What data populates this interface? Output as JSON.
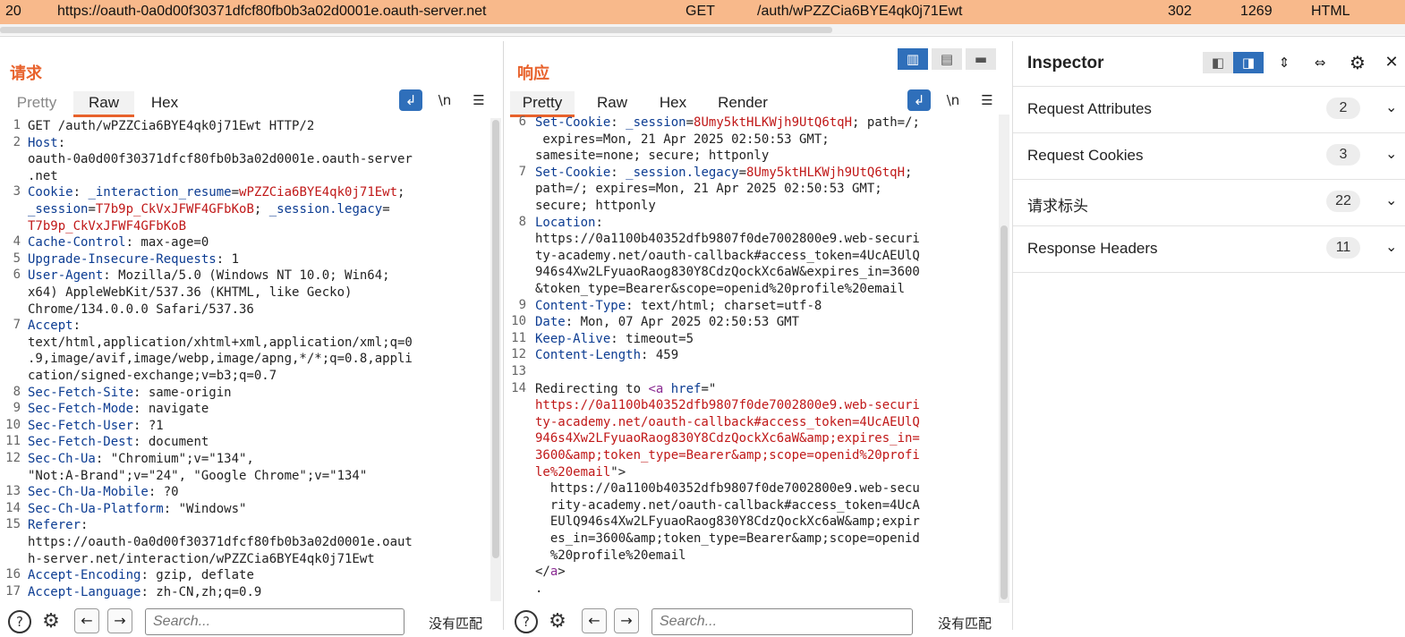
{
  "history_row": {
    "index": "20",
    "host": "https://oauth-0a0d00f30371dfcf80fb0b3a02d0001e.oauth-server.net",
    "method": "GET",
    "url": "/auth/wPZZCia6BYE4qk0j71Ewt",
    "status": "302",
    "length": "1269",
    "mime": "HTML"
  },
  "request": {
    "title": "请求",
    "tabs": [
      "Pretty",
      "Raw",
      "Hex"
    ],
    "active_tab": "Raw",
    "lines": [
      {
        "n": "1",
        "parts": [
          [
            "t",
            "GET /auth/wPZZCia6BYE4qk0j71Ewt HTTP/2"
          ]
        ]
      },
      {
        "n": "2",
        "parts": [
          [
            "h",
            "Host"
          ],
          [
            "t",
            ":"
          ]
        ]
      },
      {
        "n": "",
        "parts": [
          [
            "t",
            "oauth-0a0d00f30371dfcf80fb0b3a02d0001e.oauth-server"
          ]
        ]
      },
      {
        "n": "",
        "parts": [
          [
            "t",
            ".net"
          ]
        ]
      },
      {
        "n": "3",
        "parts": [
          [
            "h",
            "Cookie"
          ],
          [
            "t",
            ": "
          ],
          [
            "h",
            "_interaction_resume"
          ],
          [
            "t",
            "="
          ],
          [
            "c",
            "wPZZCia6BYE4qk0j71Ewt"
          ],
          [
            "t",
            ";"
          ]
        ]
      },
      {
        "n": "",
        "parts": [
          [
            "h",
            "_session"
          ],
          [
            "t",
            "="
          ],
          [
            "c",
            "T7b9p_CkVxJFWF4GFbKoB"
          ],
          [
            "t",
            "; "
          ],
          [
            "h",
            "_session.legacy"
          ],
          [
            "t",
            "="
          ]
        ]
      },
      {
        "n": "",
        "parts": [
          [
            "c",
            "T7b9p_CkVxJFWF4GFbKoB"
          ]
        ]
      },
      {
        "n": "4",
        "parts": [
          [
            "h",
            "Cache-Control"
          ],
          [
            "t",
            ": max-age=0"
          ]
        ]
      },
      {
        "n": "5",
        "parts": [
          [
            "h",
            "Upgrade-Insecure-Requests"
          ],
          [
            "t",
            ": 1"
          ]
        ]
      },
      {
        "n": "6",
        "parts": [
          [
            "h",
            "User-Agent"
          ],
          [
            "t",
            ": Mozilla/5.0 (Windows NT 10.0; Win64;"
          ]
        ]
      },
      {
        "n": "",
        "parts": [
          [
            "t",
            "x64) AppleWebKit/537.36 (KHTML, like Gecko)"
          ]
        ]
      },
      {
        "n": "",
        "parts": [
          [
            "t",
            "Chrome/134.0.0.0 Safari/537.36"
          ]
        ]
      },
      {
        "n": "7",
        "parts": [
          [
            "h",
            "Accept"
          ],
          [
            "t",
            ":"
          ]
        ]
      },
      {
        "n": "",
        "parts": [
          [
            "t",
            "text/html,application/xhtml+xml,application/xml;q=0"
          ]
        ]
      },
      {
        "n": "",
        "parts": [
          [
            "t",
            ".9,image/avif,image/webp,image/apng,*/*;q=0.8,appli"
          ]
        ]
      },
      {
        "n": "",
        "parts": [
          [
            "t",
            "cation/signed-exchange;v=b3;q=0.7"
          ]
        ]
      },
      {
        "n": "8",
        "parts": [
          [
            "h",
            "Sec-Fetch-Site"
          ],
          [
            "t",
            ": same-origin"
          ]
        ]
      },
      {
        "n": "9",
        "parts": [
          [
            "h",
            "Sec-Fetch-Mode"
          ],
          [
            "t",
            ": navigate"
          ]
        ]
      },
      {
        "n": "10",
        "parts": [
          [
            "h",
            "Sec-Fetch-User"
          ],
          [
            "t",
            ": ?1"
          ]
        ]
      },
      {
        "n": "11",
        "parts": [
          [
            "h",
            "Sec-Fetch-Dest"
          ],
          [
            "t",
            ": document"
          ]
        ]
      },
      {
        "n": "12",
        "parts": [
          [
            "h",
            "Sec-Ch-Ua"
          ],
          [
            "t",
            ": \"Chromium\";v=\"134\","
          ]
        ]
      },
      {
        "n": "",
        "parts": [
          [
            "t",
            "\"Not:A-Brand\";v=\"24\", \"Google Chrome\";v=\"134\""
          ]
        ]
      },
      {
        "n": "13",
        "parts": [
          [
            "h",
            "Sec-Ch-Ua-Mobile"
          ],
          [
            "t",
            ": ?0"
          ]
        ]
      },
      {
        "n": "14",
        "parts": [
          [
            "h",
            "Sec-Ch-Ua-Platform"
          ],
          [
            "t",
            ": \"Windows\""
          ]
        ]
      },
      {
        "n": "15",
        "parts": [
          [
            "h",
            "Referer"
          ],
          [
            "t",
            ":"
          ]
        ]
      },
      {
        "n": "",
        "parts": [
          [
            "t",
            "https://oauth-0a0d00f30371dfcf80fb0b3a02d0001e.oaut"
          ]
        ]
      },
      {
        "n": "",
        "parts": [
          [
            "t",
            "h-server.net/interaction/wPZZCia6BYE4qk0j71Ewt"
          ]
        ]
      },
      {
        "n": "16",
        "parts": [
          [
            "h",
            "Accept-Encoding"
          ],
          [
            "t",
            ": gzip, deflate"
          ]
        ]
      },
      {
        "n": "17",
        "parts": [
          [
            "h",
            "Accept-Language"
          ],
          [
            "t",
            ": zh-CN,zh;q=0.9"
          ]
        ]
      }
    ],
    "search_placeholder": "Search...",
    "no_match": "没有匹配"
  },
  "response": {
    "title": "响应",
    "tabs": [
      "Pretty",
      "Raw",
      "Hex",
      "Render"
    ],
    "active_tab": "Pretty",
    "lines": [
      {
        "n": "6",
        "parts": [
          [
            "h",
            "Set-Cookie"
          ],
          [
            "t",
            ": "
          ],
          [
            "h",
            "_session"
          ],
          [
            "t",
            "="
          ],
          [
            "c",
            "8Umy5ktHLKWjh9UtQ6tqH"
          ],
          [
            "t",
            "; path=/;"
          ]
        ]
      },
      {
        "n": "",
        "parts": [
          [
            "t",
            " expires=Mon, 21 Apr 2025 02:50:53 GMT;"
          ]
        ]
      },
      {
        "n": "",
        "parts": [
          [
            "t",
            "samesite=none; secure; httponly"
          ]
        ]
      },
      {
        "n": "7",
        "parts": [
          [
            "h",
            "Set-Cookie"
          ],
          [
            "t",
            ": "
          ],
          [
            "h",
            "_session.legacy"
          ],
          [
            "t",
            "="
          ],
          [
            "c",
            "8Umy5ktHLKWjh9UtQ6tqH"
          ],
          [
            "t",
            ";"
          ]
        ]
      },
      {
        "n": "",
        "parts": [
          [
            "t",
            "path=/; expires=Mon, 21 Apr 2025 02:50:53 GMT;"
          ]
        ]
      },
      {
        "n": "",
        "parts": [
          [
            "t",
            "secure; httponly"
          ]
        ]
      },
      {
        "n": "8",
        "parts": [
          [
            "h",
            "Location"
          ],
          [
            "t",
            ":"
          ]
        ]
      },
      {
        "n": "",
        "parts": [
          [
            "t",
            "https://0a1100b40352dfb9807f0de7002800e9.web-securi"
          ]
        ]
      },
      {
        "n": "",
        "parts": [
          [
            "t",
            "ty-academy.net/oauth-callback#access_token=4UcAEUlQ"
          ]
        ]
      },
      {
        "n": "",
        "parts": [
          [
            "t",
            "946s4Xw2LFyuaoRaog830Y8CdzQockXc6aW&expires_in=3600"
          ]
        ]
      },
      {
        "n": "",
        "parts": [
          [
            "t",
            "&token_type=Bearer&scope=openid%20profile%20email"
          ]
        ]
      },
      {
        "n": "9",
        "parts": [
          [
            "h",
            "Content-Type"
          ],
          [
            "t",
            ": text/html; charset=utf-8"
          ]
        ]
      },
      {
        "n": "10",
        "parts": [
          [
            "h",
            "Date"
          ],
          [
            "t",
            ": Mon, 07 Apr 2025 02:50:53 GMT"
          ]
        ]
      },
      {
        "n": "11",
        "parts": [
          [
            "h",
            "Keep-Alive"
          ],
          [
            "t",
            ": timeout=5"
          ]
        ]
      },
      {
        "n": "12",
        "parts": [
          [
            "h",
            "Content-Length"
          ],
          [
            "t",
            ": 459"
          ]
        ]
      },
      {
        "n": "13",
        "parts": [
          [
            "t",
            ""
          ]
        ]
      },
      {
        "n": "14",
        "parts": [
          [
            "t",
            "Redirecting to "
          ],
          [
            "g",
            "<a"
          ],
          [
            "t",
            " "
          ],
          [
            "h",
            "href"
          ],
          [
            "t",
            "=\""
          ]
        ]
      },
      {
        "n": "",
        "parts": [
          [
            "c",
            "https://0a1100b40352dfb9807f0de7002800e9.web-securi"
          ]
        ]
      },
      {
        "n": "",
        "parts": [
          [
            "c",
            "ty-academy.net/oauth-callback#access_token=4UcAEUlQ"
          ]
        ]
      },
      {
        "n": "",
        "parts": [
          [
            "c",
            "946s4Xw2LFyuaoRaog830Y8CdzQockXc6aW&amp;expires_in="
          ]
        ]
      },
      {
        "n": "",
        "parts": [
          [
            "c",
            "3600&amp;token_type=Bearer&amp;scope=openid%20profi"
          ]
        ]
      },
      {
        "n": "",
        "parts": [
          [
            "c",
            "le%20email"
          ],
          [
            "t",
            "\">"
          ]
        ]
      },
      {
        "n": "",
        "parts": [
          [
            "t",
            "  https://0a1100b40352dfb9807f0de7002800e9.web-secu"
          ]
        ]
      },
      {
        "n": "",
        "parts": [
          [
            "t",
            "  rity-academy.net/oauth-callback#access_token=4UcA"
          ]
        ]
      },
      {
        "n": "",
        "parts": [
          [
            "t",
            "  EUlQ946s4Xw2LFyuaoRaog830Y8CdzQockXc6aW&amp;expir"
          ]
        ]
      },
      {
        "n": "",
        "parts": [
          [
            "t",
            "  es_in=3600&amp;token_type=Bearer&amp;scope=openid"
          ]
        ]
      },
      {
        "n": "",
        "parts": [
          [
            "t",
            "  %20profile%20email"
          ]
        ]
      },
      {
        "n": "",
        "parts": [
          [
            "t",
            "</"
          ],
          [
            "g",
            "a"
          ],
          [
            "t",
            ">"
          ]
        ]
      },
      {
        "n": "",
        "parts": [
          [
            "t",
            "."
          ]
        ]
      }
    ],
    "search_placeholder": "Search...",
    "no_match": "没有匹配"
  },
  "inspector": {
    "title": "Inspector",
    "rows": [
      {
        "label": "Request Attributes",
        "count": "2"
      },
      {
        "label": "Request Cookies",
        "count": "3"
      },
      {
        "label": "请求标头",
        "count": "22"
      },
      {
        "label": "Response Headers",
        "count": "11"
      }
    ]
  },
  "icons": {
    "wrap": "↲",
    "newline": "\\n",
    "menu": "☰",
    "help": "?",
    "gear": "⚙",
    "prev": "←",
    "next": "→",
    "chevron": "⌄",
    "close": "✕"
  },
  "colors": {
    "accent": "#e8622c",
    "blue": "#2f6fba",
    "header_name": "#0c3c92",
    "cookie_value": "#c01818",
    "highlight_row": "#f8b98b"
  }
}
